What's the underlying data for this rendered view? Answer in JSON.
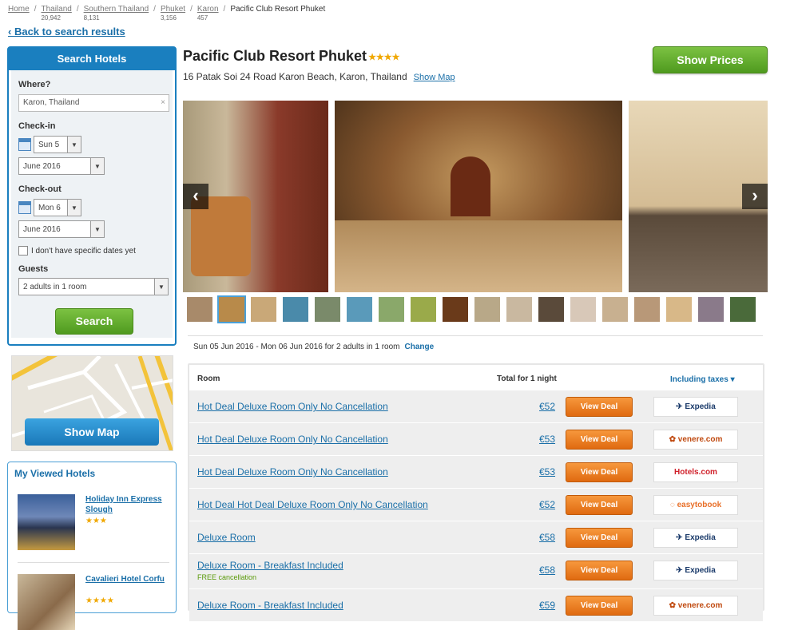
{
  "breadcrumbs": [
    {
      "label": "Home",
      "count": ""
    },
    {
      "label": "Thailand",
      "count": "20,942"
    },
    {
      "label": "Southern Thailand",
      "count": "8,131"
    },
    {
      "label": "Phuket",
      "count": "3,156"
    },
    {
      "label": "Karon",
      "count": "457"
    }
  ],
  "breadcrumb_current": "Pacific Club Resort Phuket",
  "back_link": "Back to search results",
  "search": {
    "title": "Search Hotels",
    "where_label": "Where?",
    "where_value": "Karon, Thailand",
    "checkin_label": "Check-in",
    "checkin_day": "Sun 5",
    "checkin_month": "June 2016",
    "checkout_label": "Check-out",
    "checkout_day": "Mon 6",
    "checkout_month": "June 2016",
    "no_dates_label": "I don't have specific dates yet",
    "guests_label": "Guests",
    "guests_value": "2 adults in 1 room",
    "button": "Search"
  },
  "map": {
    "button": "Show Map"
  },
  "viewed": {
    "title": "My Viewed Hotels",
    "hotels": [
      {
        "name": "Holiday Inn Express Slough",
        "stars": "★★★"
      },
      {
        "name": "Cavalieri Hotel Corfu",
        "stars": "★★★★"
      }
    ]
  },
  "hotel": {
    "name": "Pacific Club Resort Phuket",
    "stars": "★★★★",
    "address": "16 Patak Soi 24 Road Karon Beach, Karon, Thailand",
    "show_map": "Show Map",
    "show_prices": "Show Prices"
  },
  "stay_summary": "Sun 05 Jun 2016 - Mon 06 Jun 2016 for 2 adults in 1 room",
  "change_link": "Change",
  "table": {
    "col_room": "Room",
    "col_total": "Total for 1 night",
    "col_taxes": "Including taxes ▾",
    "view_deal": "View Deal",
    "rows": [
      {
        "name": "Hot Deal Deluxe Room Only No Cancellation",
        "price": "€52",
        "provider": "Expedia"
      },
      {
        "name": "Hot Deal Deluxe Room Only No Cancellation",
        "price": "€53",
        "provider": "venere.com"
      },
      {
        "name": "Hot Deal Deluxe Room Only No Cancellation",
        "price": "€53",
        "provider": "Hotels.com"
      },
      {
        "name": "Hot Deal Hot Deal Deluxe Room Only No Cancellation",
        "price": "€52",
        "provider": "easytobook"
      },
      {
        "name": "Deluxe Room",
        "price": "€58",
        "provider": "Expedia"
      },
      {
        "name": "Deluxe Room - Breakfast Included",
        "note": "FREE cancellation",
        "price": "€58",
        "provider": "Expedia"
      },
      {
        "name": "Deluxe Room - Breakfast Included",
        "price": "€59",
        "provider": "venere.com"
      }
    ]
  },
  "colors": {
    "accent": "#1a7fbf",
    "green": "#5aa82a",
    "orange": "#ef7f22",
    "star": "#f0a800"
  }
}
